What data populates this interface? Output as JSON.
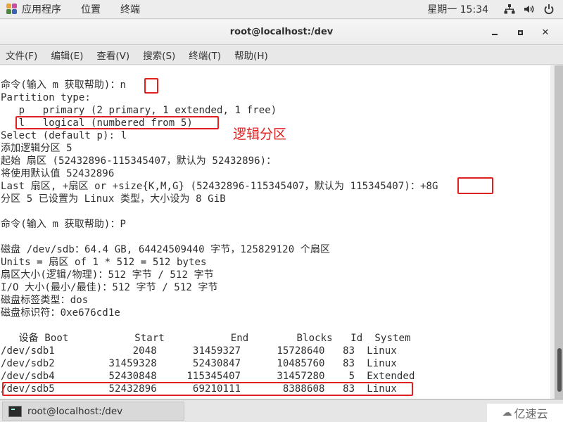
{
  "topbar": {
    "menus": [
      "应用程序",
      "位置",
      "终端"
    ],
    "clock": "星期一 15:34",
    "icons": [
      "network-icon",
      "volume-icon",
      "power-icon"
    ]
  },
  "window": {
    "title": "root@localhost:/dev",
    "buttons": [
      "minimize",
      "maximize",
      "close"
    ]
  },
  "menubar": {
    "items": [
      "文件(F)",
      "编辑(E)",
      "查看(V)",
      "搜索(S)",
      "终端(T)",
      "帮助(H)"
    ]
  },
  "terminal": {
    "lines": [
      "命令(输入 m 获取帮助)：n",
      "Partition type:",
      "   p   primary (2 primary, 1 extended, 1 free)",
      "   l   logical (numbered from 5)",
      "Select (default p): l",
      "添加逻辑分区 5",
      "起始 扇区 (52432896-115345407，默认为 52432896)：",
      "将使用默认值 52432896",
      "Last 扇区, +扇区 or +size{K,M,G} (52432896-115345407，默认为 115345407)：+8G",
      "分区 5 已设置为 Linux 类型，大小设为 8 GiB",
      "",
      "命令(输入 m 获取帮助)：P",
      "",
      "磁盘 /dev/sdb：64.4 GB, 64424509440 字节，125829120 个扇区",
      "Units = 扇区 of 1 * 512 = 512 bytes",
      "扇区大小(逻辑/物理)：512 字节 / 512 字节",
      "I/O 大小(最小/最佳)：512 字节 / 512 字节",
      "磁盘标签类型：dos",
      "磁盘标识符：0xe676cd1e",
      ""
    ],
    "table": {
      "headers": [
        "设备 Boot",
        "Start",
        "End",
        "Blocks",
        "Id",
        "System"
      ],
      "rows": [
        [
          "/dev/sdb1",
          "2048",
          "31459327",
          "15728640",
          "83",
          "Linux"
        ],
        [
          "/dev/sdb2",
          "31459328",
          "52430847",
          "10485760",
          "83",
          "Linux"
        ],
        [
          "/dev/sdb4",
          "52430848",
          "115345407",
          "31457280",
          "5",
          "Extended"
        ],
        [
          "/dev/sdb5",
          "52432896",
          "69210111",
          "8388608",
          "83",
          "Linux"
        ]
      ]
    }
  },
  "annotation": {
    "label": "逻辑分区",
    "color": "#e02020"
  },
  "taskbar": {
    "item": "root@localhost:/dev"
  },
  "watermark": {
    "text": "亿速云"
  }
}
